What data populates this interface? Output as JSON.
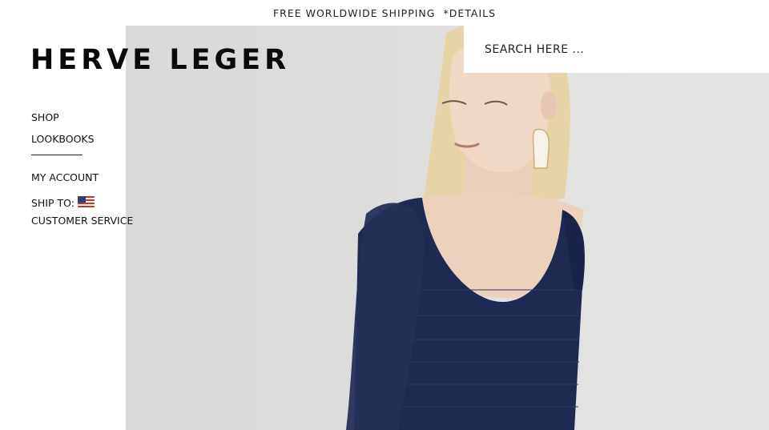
{
  "banner": {
    "shipping_text": "FREE WORLDWIDE SHIPPING",
    "details_link": "*DETAILS"
  },
  "brand": {
    "logo_text": "HERVE LEGER"
  },
  "nav": {
    "shop": "SHOP",
    "lookbooks": "LOOKBOOKS",
    "my_account": "MY ACCOUNT",
    "ship_to": "SHIP TO:",
    "ship_to_country_icon": "us-flag-icon",
    "customer_service": "CUSTOMER SERVICE"
  },
  "search": {
    "placeholder": "SEARCH HERE ..."
  },
  "colors": {
    "hero_background": "#dcdcda",
    "dress_navy": "#1c2447",
    "text": "#111111"
  }
}
